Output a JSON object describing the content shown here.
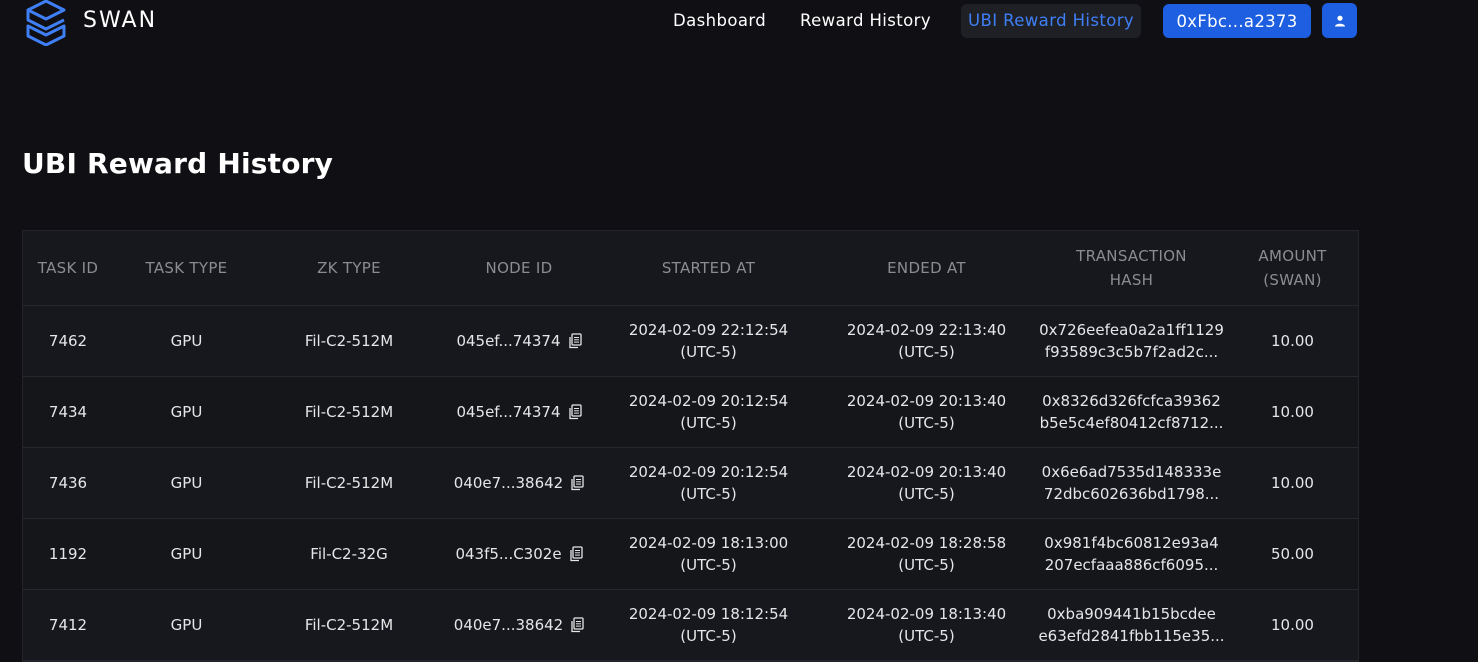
{
  "brand": {
    "name": "SWAN"
  },
  "nav": {
    "items": [
      {
        "label": "Dashboard",
        "active": false
      },
      {
        "label": "Reward History",
        "active": false
      },
      {
        "label": "UBI Reward History",
        "active": true
      }
    ],
    "wallet": "0xFbc...a2373",
    "user_icon": "user-icon"
  },
  "page": {
    "title": "UBI Reward History"
  },
  "table": {
    "headers": [
      "TASK ID",
      "TASK TYPE",
      "ZK TYPE",
      "NODE ID",
      "STARTED AT",
      "ENDED AT",
      "TRANSACTION HASH",
      "AMOUNT (SWAN)"
    ],
    "rows": [
      {
        "task_id": "7462",
        "task_type": "GPU",
        "zk_type": "Fil-C2-512M",
        "node_id": "045ef...74374",
        "started": "2024-02-09 22:12:54",
        "started_tz": "(UTC-5)",
        "ended": "2024-02-09 22:13:40",
        "ended_tz": "(UTC-5)",
        "hash1": "0x726eefea0a2a1ff1129",
        "hash2": "f93589c3c5b7f2ad2c...",
        "amount": "10.00"
      },
      {
        "task_id": "7434",
        "task_type": "GPU",
        "zk_type": "Fil-C2-512M",
        "node_id": "045ef...74374",
        "started": "2024-02-09 20:12:54",
        "started_tz": "(UTC-5)",
        "ended": "2024-02-09 20:13:40",
        "ended_tz": "(UTC-5)",
        "hash1": "0x8326d326fcfca39362",
        "hash2": "b5e5c4ef80412cf8712...",
        "amount": "10.00"
      },
      {
        "task_id": "7436",
        "task_type": "GPU",
        "zk_type": "Fil-C2-512M",
        "node_id": "040e7...38642",
        "started": "2024-02-09 20:12:54",
        "started_tz": "(UTC-5)",
        "ended": "2024-02-09 20:13:40",
        "ended_tz": "(UTC-5)",
        "hash1": "0x6e6ad7535d148333e",
        "hash2": "72dbc602636bd1798...",
        "amount": "10.00"
      },
      {
        "task_id": "1192",
        "task_type": "GPU",
        "zk_type": "Fil-C2-32G",
        "node_id": "043f5...C302e",
        "started": "2024-02-09 18:13:00",
        "started_tz": "(UTC-5)",
        "ended": "2024-02-09 18:28:58",
        "ended_tz": "(UTC-5)",
        "hash1": "0x981f4bc60812e93a4",
        "hash2": "207ecfaaa886cf6095...",
        "amount": "50.00"
      },
      {
        "task_id": "7412",
        "task_type": "GPU",
        "zk_type": "Fil-C2-512M",
        "node_id": "040e7...38642",
        "started": "2024-02-09 18:12:54",
        "started_tz": "(UTC-5)",
        "ended": "2024-02-09 18:13:40",
        "ended_tz": "(UTC-5)",
        "hash1": "0xba909441b15bcdee",
        "hash2": "e63efd2841fbb115e35...",
        "amount": "10.00"
      }
    ],
    "copy_icon": "copy-icon"
  },
  "colors": {
    "background": "#101014",
    "accent": "#1d5fe0",
    "active_link": "#3f7ff5",
    "muted": "#8b8c92"
  }
}
